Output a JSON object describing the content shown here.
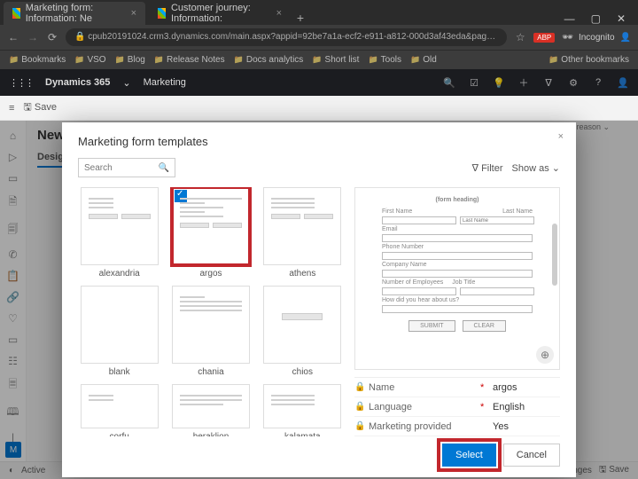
{
  "browser": {
    "tabs": [
      {
        "title": "Marketing form: Information: Ne"
      },
      {
        "title": "Customer journey: Information:"
      }
    ],
    "url": "cpub20191024.crm3.dynamics.com/main.aspx?appid=92be7a1a-ecf2-e911-a812-000d3af43eda&pagetype=entityrecord&etn=msdy…",
    "incognito_label": "Incognito",
    "badge": "ABP",
    "bookmarks": [
      "Bookmarks",
      "VSO",
      "Blog",
      "Release Notes",
      "Docs analytics",
      "Short list",
      "Tools",
      "Old"
    ],
    "other_bookmarks": "Other bookmarks"
  },
  "dynamics": {
    "product": "Dynamics 365",
    "area": "Marketing",
    "save": "Save",
    "new_label": "New l",
    "design_tab": "Design",
    "status_reason_label": "S\nus reason",
    "active": "Active",
    "unsaved": "unsaved changes",
    "save_btn": "Save",
    "m": "M"
  },
  "modal": {
    "title": "Marketing form templates",
    "search_placeholder": "Search",
    "filter": "Filter",
    "show_as": "Show as",
    "templates_row1": [
      "alexandria",
      "argos",
      "athens"
    ],
    "templates_row2": [
      "blank",
      "chania",
      "chios"
    ],
    "templates_row3": [
      "corfu",
      "heraklion",
      "kalamata"
    ],
    "selected_index": 1,
    "preview_heading": "(form heading)",
    "preview_fields": [
      "First Name",
      "Last Name",
      "Email",
      "Phone Number",
      "Phone",
      "Company Name",
      "Company",
      "Number of Employees",
      "Job Title",
      "How did you hear about us?"
    ],
    "preview_btns": [
      "SUBMIT",
      "CLEAR"
    ],
    "props": [
      {
        "label": "Name",
        "required": true,
        "value": "argos"
      },
      {
        "label": "Language",
        "required": true,
        "value": "English"
      },
      {
        "label": "Marketing provided",
        "required": false,
        "value": "Yes"
      }
    ],
    "select": "Select",
    "cancel": "Cancel"
  }
}
